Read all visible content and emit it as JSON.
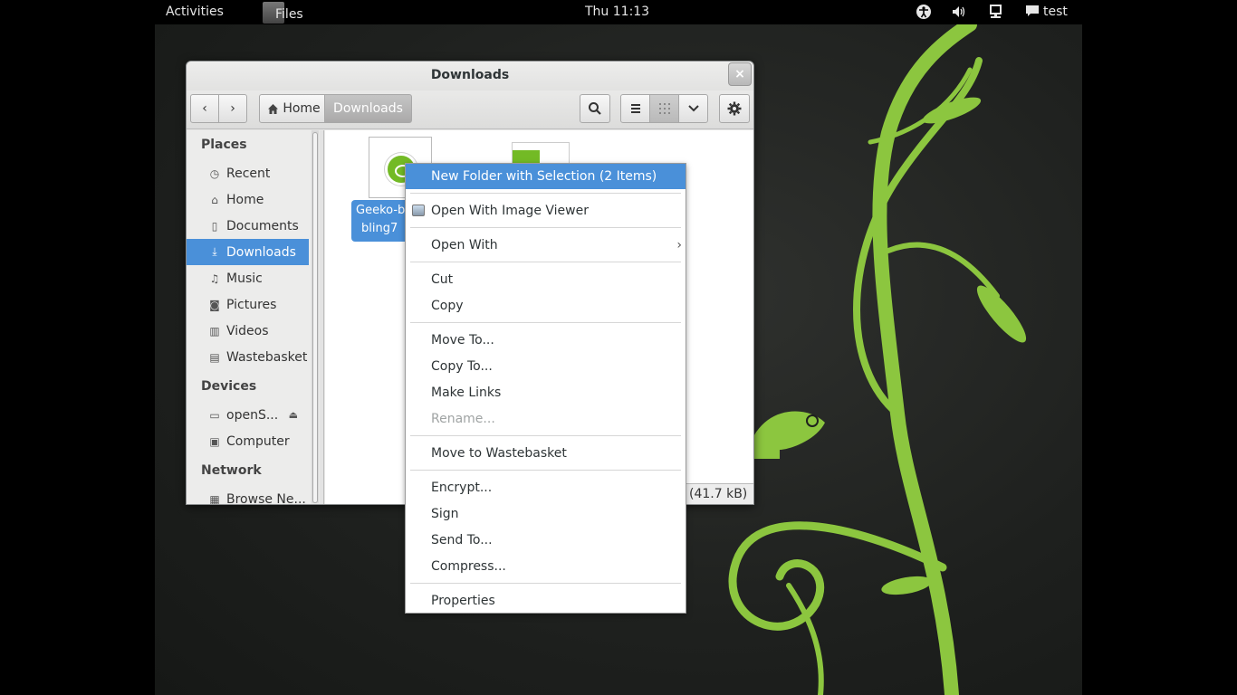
{
  "topbar": {
    "activities": "Activities",
    "app_name": "Files",
    "clock": "Thu 11:13",
    "user": "test"
  },
  "window": {
    "title": "Downloads",
    "close": "×"
  },
  "toolbar": {
    "back": "‹",
    "forward": "›",
    "crumb_home": "Home",
    "crumb_current": "Downloads"
  },
  "sidebar": {
    "places_header": "Places",
    "places": [
      {
        "label": "Recent",
        "icon": "clock-icon"
      },
      {
        "label": "Home",
        "icon": "home-icon"
      },
      {
        "label": "Documents",
        "icon": "document-icon"
      },
      {
        "label": "Downloads",
        "icon": "download-icon",
        "selected": true
      },
      {
        "label": "Music",
        "icon": "music-icon"
      },
      {
        "label": "Pictures",
        "icon": "camera-icon"
      },
      {
        "label": "Videos",
        "icon": "film-icon"
      },
      {
        "label": "Wastebasket",
        "icon": "trash-icon"
      }
    ],
    "devices_header": "Devices",
    "devices": [
      {
        "label": "openS...",
        "icon": "drive-icon"
      },
      {
        "label": "Computer",
        "icon": "computer-icon"
      }
    ],
    "network_header": "Network",
    "network": [
      {
        "label": "Browse Ne...",
        "icon": "network-icon"
      }
    ]
  },
  "content": {
    "file1_label_line1": "Geeko-b",
    "file1_label_line2": "bling7",
    "status_size": "(41.7 kB)"
  },
  "context_menu": {
    "items": [
      {
        "label": "New Folder with Selection (2 Items)"
      },
      {
        "label": "Open With Image Viewer"
      },
      {
        "label": "Open With"
      },
      {
        "label": "Cut"
      },
      {
        "label": "Copy"
      },
      {
        "label": "Move To..."
      },
      {
        "label": "Copy To..."
      },
      {
        "label": "Make Links"
      },
      {
        "label": "Rename..."
      },
      {
        "label": "Move to Wastebasket"
      },
      {
        "label": "Encrypt..."
      },
      {
        "label": "Sign"
      },
      {
        "label": "Send To..."
      },
      {
        "label": "Compress..."
      },
      {
        "label": "Properties"
      }
    ]
  },
  "colors": {
    "selection": "#4a90d9",
    "desktop_vine": "#8cc63f",
    "topbar": "#000000"
  }
}
